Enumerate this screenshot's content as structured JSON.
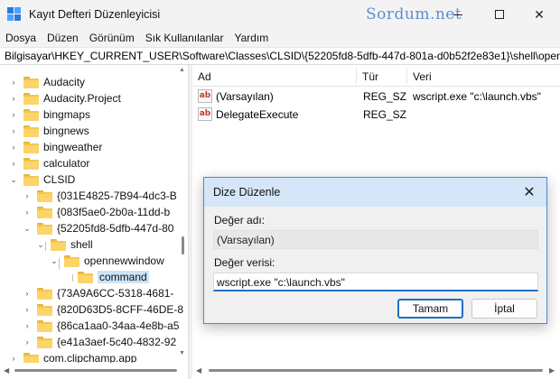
{
  "window": {
    "title": "Kayıt Defteri Düzenleyicisi",
    "watermark": "Sordum.net",
    "controls": [
      "minimize",
      "maximize",
      "close"
    ],
    "close_glyph": "✕"
  },
  "menu": [
    "Dosya",
    "Düzen",
    "Görünüm",
    "Sık Kullanılanlar",
    "Yardım"
  ],
  "address": "Bilgisayar\\HKEY_CURRENT_USER\\Software\\Classes\\CLSID\\{52205fd8-5dfb-447d-801a-d0b52f2e83e1}\\shell\\opennewwindow\\command",
  "tree": [
    {
      "label": "Audacity",
      "expander": "›"
    },
    {
      "label": "Audacity.Project",
      "expander": "›"
    },
    {
      "label": "bingmaps",
      "expander": "›"
    },
    {
      "label": "bingnews",
      "expander": "›"
    },
    {
      "label": "bingweather",
      "expander": "›"
    },
    {
      "label": "calculator",
      "expander": "›"
    },
    {
      "label": "CLSID",
      "expander": "⌄"
    },
    {
      "label": "{031E4825-7B94-4dc3-B",
      "expander": "›"
    },
    {
      "label": "{083f5ae0-2b0a-11dd-b",
      "expander": "›"
    },
    {
      "label": "{52205fd8-5dfb-447d-80",
      "expander": "⌄"
    },
    {
      "label": "shell",
      "expander": "⌄"
    },
    {
      "label": "opennewwindow",
      "expander": "⌄"
    },
    {
      "label": "command",
      "expander": "",
      "selected": true
    },
    {
      "label": "{73A9A6CC-5318-4681-",
      "expander": "›"
    },
    {
      "label": "{820D63D5-8CFF-46DE-8",
      "expander": "›"
    },
    {
      "label": "{86ca1aa0-34aa-4e8b-a5",
      "expander": "›"
    },
    {
      "label": "{e41a3aef-5c40-4832-92",
      "expander": "›"
    },
    {
      "label": "com.clipchamp.app",
      "expander": "›"
    }
  ],
  "list": {
    "columns": [
      "Ad",
      "Tür",
      "Veri"
    ],
    "rows": [
      {
        "name": "(Varsayılan)",
        "type": "REG_SZ",
        "data": "wscript.exe \"c:\\launch.vbs\""
      },
      {
        "name": "DelegateExecute",
        "type": "REG_SZ",
        "data": ""
      }
    ],
    "value_icon_text": "ab"
  },
  "dialog": {
    "title": "Dize Düzenle",
    "name_label": "Değer adı:",
    "name_value": "(Varsayılan)",
    "data_label": "Değer verisi:",
    "data_value": "wscript.exe \"c:\\launch.vbs\"",
    "ok_label": "Tamam",
    "cancel_label": "İptal",
    "accent": "#1f6fc4"
  },
  "colors": {
    "folder": "#f5c64e",
    "selection": "#cce4f7",
    "watermark": "#5b8fd0"
  }
}
